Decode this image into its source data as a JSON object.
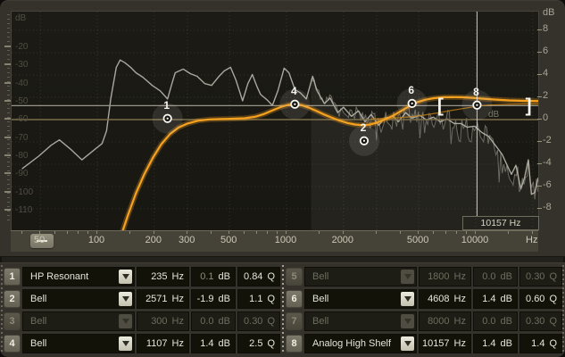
{
  "graph": {
    "left_scale_title": "dB",
    "right_scale_title": "dB",
    "freq_axis_unit": "Hz",
    "zero_line_label": "dB",
    "cursor_readout": "10157 Hz",
    "colors": {
      "eq_curve": "#f6a11f",
      "band_curve": "#b87a14",
      "spectrum": "#b6b3aa",
      "zero_line": "#7c6e4a",
      "gain_guide_line": "#97948a",
      "cursor_line": "#e8e6e0",
      "marker_white": "#f7f6f1"
    }
  },
  "chart_data": {
    "type": "line",
    "x_axis": {
      "scale": "log",
      "unit": "Hz",
      "labels": [
        50,
        100,
        200,
        300,
        500,
        1000,
        2000,
        5000,
        10000
      ],
      "range": [
        34,
        24000
      ]
    },
    "left_scale": {
      "title": "dB",
      "ticks": [
        -20,
        -30,
        -40,
        -50,
        -60,
        -70,
        -80,
        -90,
        -100,
        -110
      ],
      "purpose": "analyzer level"
    },
    "right_scale": {
      "title": "dB",
      "ticks": [
        8,
        6,
        4,
        2,
        0,
        -2,
        -4,
        -6,
        -8
      ],
      "purpose": "eq gain",
      "ylim": [
        -8,
        8
      ]
    },
    "grid_freqs": [
      50,
      100,
      200,
      300,
      500,
      1000,
      2000,
      3000,
      5000,
      10000,
      20000
    ],
    "eq_curve": [
      [
        120,
        -13
      ],
      [
        133,
        -10.5
      ],
      [
        145,
        -8.6
      ],
      [
        160,
        -6.6
      ],
      [
        177,
        -4.9
      ],
      [
        197,
        -3.4
      ],
      [
        218,
        -2.2
      ],
      [
        242,
        -1.3
      ],
      [
        268,
        -0.72
      ],
      [
        300,
        -0.35
      ],
      [
        340,
        -0.1
      ],
      [
        390,
        0.02
      ],
      [
        450,
        0.05
      ],
      [
        520,
        0.08
      ],
      [
        600,
        0.12
      ],
      [
        680,
        0.25
      ],
      [
        760,
        0.5
      ],
      [
        850,
        0.85
      ],
      [
        940,
        1.15
      ],
      [
        1020,
        1.32
      ],
      [
        1107,
        1.38
      ],
      [
        1200,
        1.3
      ],
      [
        1300,
        1.1
      ],
      [
        1420,
        0.82
      ],
      [
        1560,
        0.5
      ],
      [
        1720,
        0.2
      ],
      [
        1900,
        -0.08
      ],
      [
        2100,
        -0.3
      ],
      [
        2300,
        -0.44
      ],
      [
        2520,
        -0.5
      ],
      [
        2750,
        -0.45
      ],
      [
        3000,
        -0.28
      ],
      [
        3300,
        0
      ],
      [
        3700,
        0.4
      ],
      [
        4100,
        0.85
      ],
      [
        4500,
        1.25
      ],
      [
        4900,
        1.55
      ],
      [
        5400,
        1.78
      ],
      [
        6000,
        1.92
      ],
      [
        6700,
        2.0
      ],
      [
        7500,
        2.02
      ],
      [
        8500,
        2.0
      ],
      [
        9600,
        1.95
      ],
      [
        10800,
        1.88
      ],
      [
        12500,
        1.8
      ],
      [
        15000,
        1.72
      ],
      [
        18000,
        1.68
      ],
      [
        22000,
        1.66
      ],
      [
        24500,
        1.65
      ]
    ],
    "band8_curve": [
      [
        2800,
        0.06
      ],
      [
        3500,
        0.12
      ],
      [
        4300,
        0.22
      ],
      [
        5200,
        0.38
      ],
      [
        6300,
        0.6
      ],
      [
        7600,
        0.85
      ],
      [
        9000,
        1.05
      ],
      [
        10157,
        1.2
      ],
      [
        12000,
        1.32
      ],
      [
        15000,
        1.38
      ],
      [
        19000,
        1.4
      ],
      [
        24000,
        1.4
      ]
    ],
    "spectrum": [
      [
        40,
        -87
      ],
      [
        49,
        -80
      ],
      [
        57,
        -74
      ],
      [
        63,
        -71
      ],
      [
        72,
        -76
      ],
      [
        83,
        -82
      ],
      [
        95,
        -77
      ],
      [
        106,
        -73
      ],
      [
        112,
        -66
      ],
      [
        118,
        -48
      ],
      [
        126,
        -31
      ],
      [
        132,
        -27
      ],
      [
        140,
        -28.5
      ],
      [
        150,
        -31
      ],
      [
        160,
        -34
      ],
      [
        174,
        -36.5
      ],
      [
        195,
        -41
      ],
      [
        215,
        -44
      ],
      [
        235,
        -48.5
      ],
      [
        248,
        -40
      ],
      [
        258,
        -34
      ],
      [
        285,
        -32
      ],
      [
        310,
        -34.5
      ],
      [
        337,
        -36
      ],
      [
        370,
        -40
      ],
      [
        402,
        -41
      ],
      [
        440,
        -36
      ],
      [
        469,
        -33
      ],
      [
        506,
        -31
      ],
      [
        540,
        -38
      ],
      [
        586,
        -49.5
      ],
      [
        625,
        -40
      ],
      [
        660,
        -35
      ],
      [
        700,
        -42
      ],
      [
        730,
        -46
      ],
      [
        790,
        -49
      ],
      [
        842,
        -52
      ],
      [
        900,
        -44
      ],
      [
        971,
        -31.5
      ],
      [
        1030,
        -34
      ],
      [
        1110,
        -43.5
      ],
      [
        1180,
        -45
      ],
      [
        1273,
        -48.5
      ],
      [
        1375,
        -36
      ],
      [
        1450,
        -44
      ],
      [
        1587,
        -51
      ],
      [
        1700,
        -48
      ],
      [
        1864,
        -56
      ],
      [
        2000,
        -53
      ],
      [
        2204,
        -58
      ],
      [
        2400,
        -55
      ],
      [
        2598,
        -61
      ],
      [
        2800,
        -57
      ],
      [
        3071,
        -63
      ],
      [
        3300,
        -59
      ],
      [
        3664,
        -58
      ],
      [
        3900,
        -61
      ],
      [
        4265,
        -56
      ],
      [
        4600,
        -59
      ],
      [
        5047,
        -57.5
      ],
      [
        5500,
        -60
      ],
      [
        5972,
        -58.5
      ],
      [
        6500,
        -61
      ],
      [
        7056,
        -59.5
      ],
      [
        7700,
        -62
      ],
      [
        8345,
        -62
      ],
      [
        9000,
        -64
      ],
      [
        9850,
        -63.5
      ],
      [
        10800,
        -67
      ],
      [
        11656,
        -69
      ],
      [
        12700,
        -74
      ],
      [
        13787,
        -79
      ],
      [
        14800,
        -86
      ],
      [
        15445,
        -90
      ],
      [
        16300,
        -85
      ],
      [
        17302,
        -98
      ],
      [
        18100,
        -92
      ],
      [
        18960,
        -82
      ],
      [
        19700,
        -101
      ],
      [
        20500,
        -100
      ],
      [
        21400,
        -92
      ],
      [
        22400,
        -98
      ],
      [
        23200,
        -96
      ]
    ],
    "fft_noise": {
      "f_start": 1350,
      "f_end": 23000,
      "points": 150,
      "amplitude_db": 5
    },
    "ref_lines": {
      "zero_line_db": 0,
      "gain_guide_db": 1.25
    },
    "markers": [
      {
        "label": "1",
        "freq": 235,
        "gain_db": 0.1
      },
      {
        "label": "2",
        "freq": 2571,
        "gain_db": -1.9
      },
      {
        "label": "4",
        "freq": 1107,
        "gain_db": 1.38
      },
      {
        "label": "6",
        "freq": 4608,
        "gain_db": 1.45
      },
      {
        "label": "8",
        "freq": 10157,
        "gain_db": 1.3,
        "selected": true
      }
    ],
    "selection": {
      "band": "8",
      "bracket_left_freq": 6500,
      "bracket_right_freq": 19000,
      "bracket_gain_db": 1.3,
      "cursor_freq": 10157
    }
  },
  "table": {
    "rows": [
      {
        "number": "1",
        "type": "HP Resonant",
        "freq": "235",
        "freq_unit": "Hz",
        "gain": "0.1",
        "gain_unit": "dB",
        "q": "0.84",
        "q_unit": "Q",
        "active": true,
        "gain_dimmed": true
      },
      {
        "number": "2",
        "type": "Bell",
        "freq": "2571",
        "freq_unit": "Hz",
        "gain": "-1.9",
        "gain_unit": "dB",
        "q": "1.1",
        "q_unit": "Q",
        "active": true,
        "gain_dimmed": false
      },
      {
        "number": "3",
        "type": "Bell",
        "freq": "300",
        "freq_unit": "Hz",
        "gain": "0.0",
        "gain_unit": "dB",
        "q": "0.30",
        "q_unit": "Q",
        "active": false,
        "gain_dimmed": false
      },
      {
        "number": "4",
        "type": "Bell",
        "freq": "1107",
        "freq_unit": "Hz",
        "gain": "1.4",
        "gain_unit": "dB",
        "q": "2.5",
        "q_unit": "Q",
        "active": true,
        "gain_dimmed": false
      },
      {
        "number": "5",
        "type": "Bell",
        "freq": "1800",
        "freq_unit": "Hz",
        "gain": "0.0",
        "gain_unit": "dB",
        "q": "0.30",
        "q_unit": "Q",
        "active": false,
        "gain_dimmed": false
      },
      {
        "number": "6",
        "type": "Bell",
        "freq": "4608",
        "freq_unit": "Hz",
        "gain": "1.4",
        "gain_unit": "dB",
        "q": "0.60",
        "q_unit": "Q",
        "active": true,
        "gain_dimmed": false
      },
      {
        "number": "7",
        "type": "Bell",
        "freq": "8000",
        "freq_unit": "Hz",
        "gain": "0.0",
        "gain_unit": "dB",
        "q": "0.30",
        "q_unit": "Q",
        "active": false,
        "gain_dimmed": false
      },
      {
        "number": "8",
        "type": "Analog High Shelf",
        "freq": "10157",
        "freq_unit": "Hz",
        "gain": "1.4",
        "gain_unit": "dB",
        "q": "1.4",
        "q_unit": "Q",
        "active": true,
        "gain_dimmed": false,
        "selected": true
      }
    ]
  }
}
